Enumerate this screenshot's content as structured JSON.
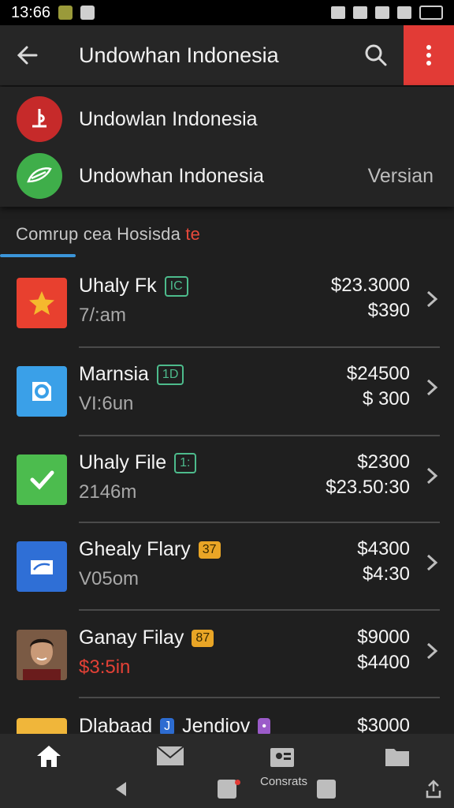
{
  "status_bar": {
    "time": "13:66"
  },
  "app_bar": {
    "title": "Undowhan Indonesia"
  },
  "accounts": [
    {
      "name": "Undowlan Indonesia",
      "version": ""
    },
    {
      "name": "Undowhan Indonesia",
      "version": "Versian"
    }
  ],
  "section": {
    "title_main": "Comrup cea Hosisda",
    "title_accent": "te"
  },
  "items": [
    {
      "title": "Uhaly Fk",
      "badge": "IC",
      "sub": "7/:am",
      "price1": "$23.3000",
      "price2": "$390"
    },
    {
      "title": "Marnsia",
      "badge": "1D",
      "sub": "VI:6un",
      "price1": "$24500",
      "price2": "$ 300"
    },
    {
      "title": "Uhaly File",
      "badge": "1:",
      "sub": "2146m",
      "price1": "$2300",
      "price2": "$23.50:30"
    },
    {
      "title": "Ghealy Flary",
      "badge": "37",
      "sub": "V05om",
      "price1": "$4300",
      "price2": "$4:30"
    },
    {
      "title": "Ganay Filay",
      "badge": "87",
      "sub": "$3:5in",
      "price1": "$9000",
      "price2": "$4400"
    },
    {
      "title": "Dlabaad",
      "badge": "J",
      "title2": "Jendiov",
      "price1": "$3000"
    }
  ],
  "bottom_nav": {
    "label": "Consrats"
  },
  "colors": {
    "accent_red": "#e23b36",
    "accent_blue": "#3b95d9",
    "background": "#1f1f1f"
  }
}
